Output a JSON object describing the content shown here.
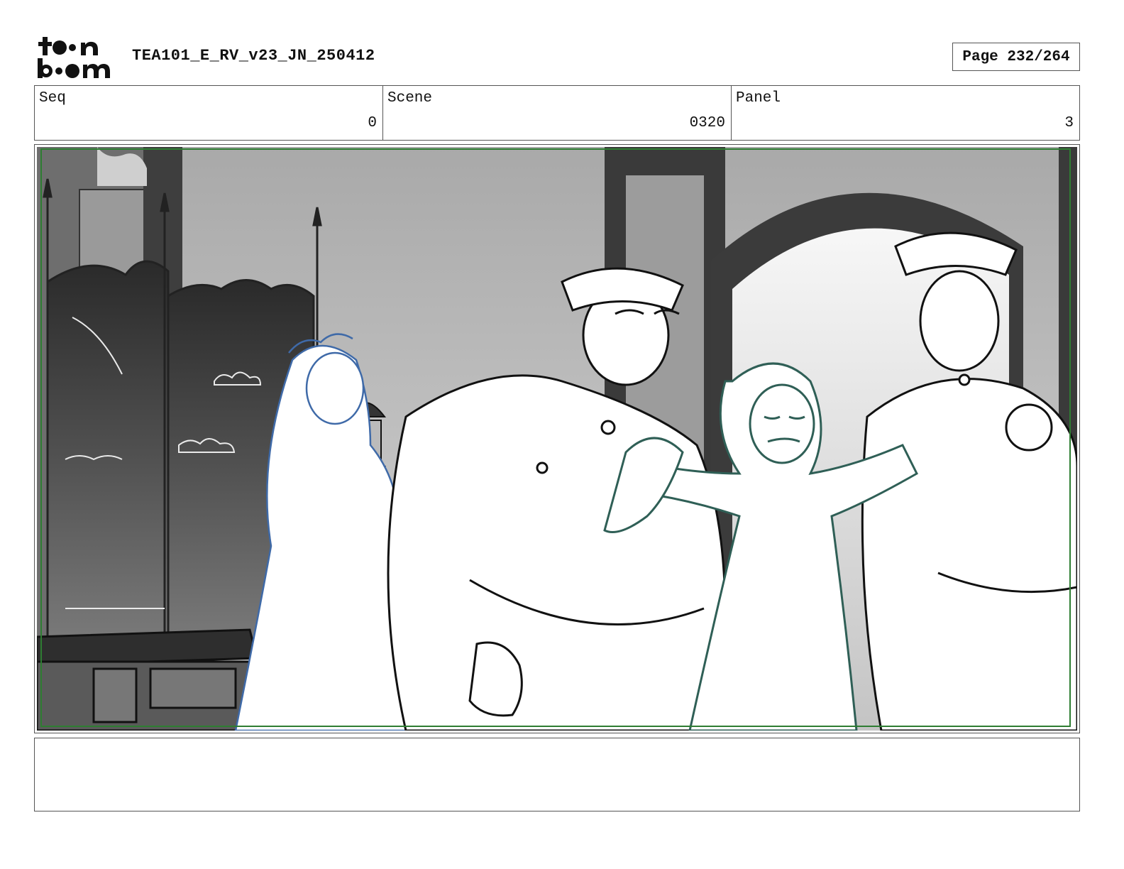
{
  "header": {
    "logo_text": "toon boom",
    "title": "TEA101_E_RV_v23_JN_250412",
    "page": "Page 232/264"
  },
  "fields": [
    {
      "label": "Seq",
      "value": "0"
    },
    {
      "label": "Scene",
      "value": "0320"
    },
    {
      "label": "Panel",
      "value": "3"
    }
  ],
  "panel": {
    "frame_color": "#2e7d32",
    "notes": ""
  }
}
